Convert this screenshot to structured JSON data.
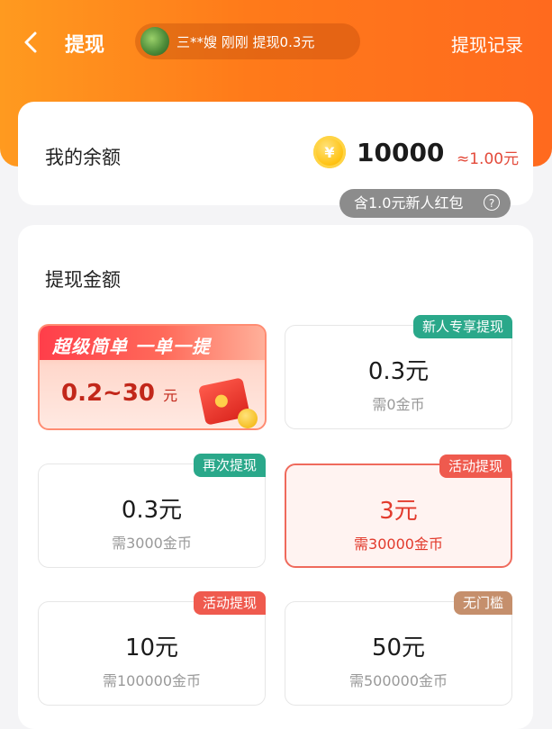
{
  "header": {
    "title": "提现",
    "ticker": "三**嫂  刚刚  提现0.3元",
    "record_link": "提现记录"
  },
  "balance": {
    "label": "我的余额",
    "coin_symbol": "¥",
    "coins": "10000",
    "approx": "≈1.00元",
    "new_user_note": "含1.0元新人红包",
    "help_symbol": "?"
  },
  "withdraw": {
    "section_title": "提现金额",
    "promo": {
      "slogan": "超级简单 一单一提",
      "range": "0.2~30",
      "unit": "元"
    },
    "options": [
      {
        "tag": "新人专享提现",
        "amount": "0.3元",
        "need": "需0金币",
        "tag_color": "green"
      },
      {
        "tag": "再次提现",
        "amount": "0.3元",
        "need": "需3000金币",
        "tag_color": "green"
      },
      {
        "tag": "活动提现",
        "amount": "3元",
        "need": "需30000金币",
        "tag_color": "red"
      },
      {
        "tag": "活动提现",
        "amount": "10元",
        "need": "需100000金币",
        "tag_color": "red"
      },
      {
        "tag": "无门槛",
        "amount": "50元",
        "need": "需500000金币",
        "tag_color": "tan"
      }
    ]
  },
  "colors": {
    "header_orange": "#ff7a1a",
    "accent_red": "#e23a2c",
    "tag_green": "#2aa88a",
    "tag_red": "#ef5a4e",
    "tag_tan": "#c58f6c"
  }
}
